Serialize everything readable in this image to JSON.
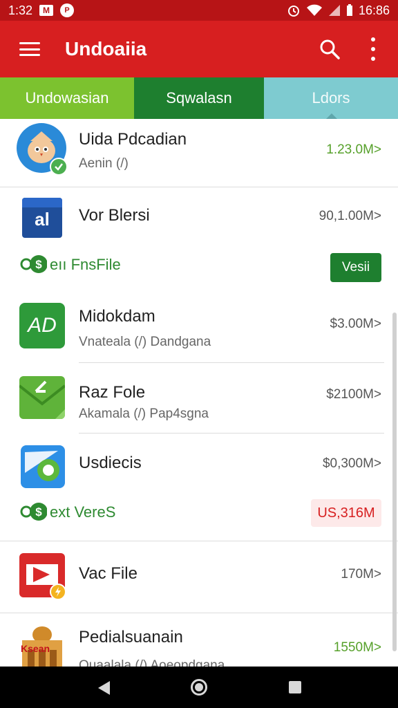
{
  "status_bar": {
    "time": "1:32",
    "mail_icon": "gmail-icon",
    "circle_icon_text": "P",
    "alarm_icon": "alarm-icon",
    "clock": "16:86"
  },
  "app_bar": {
    "title": "Undoaiia"
  },
  "tabs": [
    {
      "label": "Undowasian"
    },
    {
      "label": "Sqwalasn"
    },
    {
      "label": "Ldors"
    }
  ],
  "items": [
    {
      "name": "Uida Pdcadian",
      "subtitle": "Aenin (/)",
      "size": "1.23.0M>"
    },
    {
      "name": "Vor Blersi",
      "size": "90,1.00M>",
      "action_label": "eıı FnsFile",
      "button_label": "Vesii",
      "icon_text": "al"
    },
    {
      "name": "Midokdam",
      "subtitle": "Vnateala (/) Dandgana",
      "size": "$3.00M>",
      "icon_text": "AD"
    },
    {
      "name": "Raz Fole",
      "subtitle": "Akamala (/) Pap4sgna",
      "size": "$2100M>"
    },
    {
      "name": "Usdiecis",
      "size": "$0,300M>",
      "action_label": "ext VereS",
      "button_label": "US,316M"
    },
    {
      "name": "Vac File",
      "size": "170M>"
    },
    {
      "name": "Pedialsuanain",
      "subtitle": "Ouaalala (/) Aoeopdgana",
      "size": "1550M>",
      "icon_text": "Ksean"
    }
  ],
  "colors": {
    "appbar": "#d71f20",
    "statusbar": "#b71416",
    "tab1": "#7cc22f",
    "tab2": "#1e7f2f",
    "tab3": "#7ecbd0",
    "accent_green": "#2e8a31"
  }
}
